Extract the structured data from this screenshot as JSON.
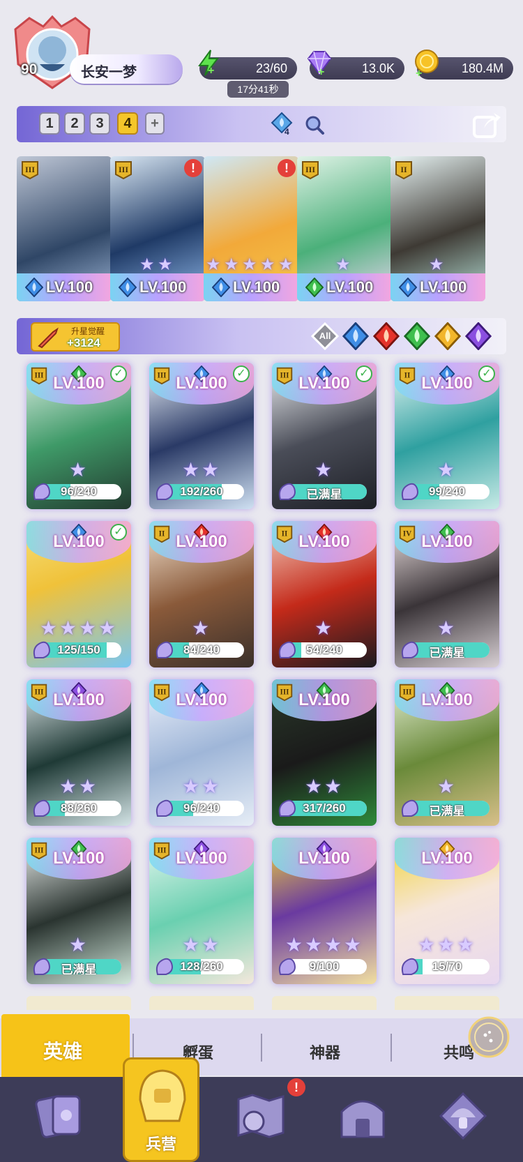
{
  "player": {
    "level": "90",
    "name": "长安一梦"
  },
  "resources": {
    "energy": "23/60",
    "energy_timer": "17分41秒",
    "gems": "13.0K",
    "gold": "180.4M"
  },
  "teams": {
    "tabs": [
      "1",
      "2",
      "3",
      "4",
      "+"
    ],
    "active": "4",
    "power_count": "4"
  },
  "team_cards": [
    {
      "level": "LV.100",
      "element": "water",
      "rank": "III",
      "alert": false,
      "stars": 0
    },
    {
      "level": "LV.100",
      "element": "water",
      "rank": "III",
      "alert": true,
      "stars": 2
    },
    {
      "level": "LV.100",
      "element": "water",
      "rank": "",
      "alert": true,
      "stars": 5
    },
    {
      "level": "LV.100",
      "element": "nature",
      "rank": "III",
      "alert": false,
      "stars": 1
    },
    {
      "level": "LV.100",
      "element": "water",
      "rank": "II",
      "alert": false,
      "stars": 1
    }
  ],
  "awaken": {
    "label": "升星觉醒",
    "value": "+3124"
  },
  "filters": [
    "All",
    "water",
    "fire",
    "nature",
    "light",
    "dark"
  ],
  "heroes": [
    {
      "level": "LV.100",
      "element": "nature",
      "rank": "III",
      "check": true,
      "count": "96/240",
      "progress": 0.4,
      "stars": 1
    },
    {
      "level": "LV.100",
      "element": "water",
      "rank": "III",
      "check": true,
      "count": "192/260",
      "progress": 0.74,
      "stars": 2
    },
    {
      "level": "LV.100",
      "element": "water",
      "rank": "III",
      "check": true,
      "count": "已满星",
      "progress": 1.0,
      "stars": 1
    },
    {
      "level": "LV.100",
      "element": "water",
      "rank": "II",
      "check": true,
      "count": "99/240",
      "progress": 0.41,
      "stars": 1
    },
    {
      "level": "LV.100",
      "element": "water",
      "rank": "",
      "check": true,
      "count": "125/150",
      "progress": 0.83,
      "stars": 4
    },
    {
      "level": "LV.100",
      "element": "fire",
      "rank": "II",
      "check": false,
      "count": "84/240",
      "progress": 0.35,
      "stars": 1
    },
    {
      "level": "LV.100",
      "element": "fire",
      "rank": "II",
      "check": false,
      "count": "54/240",
      "progress": 0.23,
      "stars": 1
    },
    {
      "level": "LV.100",
      "element": "nature",
      "rank": "IV",
      "check": false,
      "count": "已满星",
      "progress": 1.0,
      "stars": 1
    },
    {
      "level": "LV.100",
      "element": "dark",
      "rank": "III",
      "check": false,
      "count": "88/260",
      "progress": 0.34,
      "stars": 2
    },
    {
      "level": "LV.100",
      "element": "water",
      "rank": "III",
      "check": false,
      "count": "96/240",
      "progress": 0.4,
      "stars": 2
    },
    {
      "level": "LV.100",
      "element": "nature",
      "rank": "III",
      "check": false,
      "count": "317/260",
      "progress": 1.0,
      "stars": 2
    },
    {
      "level": "LV.100",
      "element": "nature",
      "rank": "III",
      "check": false,
      "count": "已满星",
      "progress": 1.0,
      "stars": 1
    },
    {
      "level": "LV.100",
      "element": "nature",
      "rank": "III",
      "check": false,
      "count": "已满星",
      "progress": 1.0,
      "stars": 1
    },
    {
      "level": "LV.100",
      "element": "dark",
      "rank": "III",
      "check": false,
      "count": "128/260",
      "progress": 0.49,
      "stars": 2
    },
    {
      "level": "LV.100",
      "element": "dark",
      "rank": "",
      "check": false,
      "count": "9/100",
      "progress": 0.09,
      "stars": 4
    },
    {
      "level": "LV.100",
      "element": "light",
      "rank": "",
      "check": false,
      "count": "15/70",
      "progress": 0.21,
      "stars": 3
    }
  ],
  "sub_tabs": [
    "英雄",
    "孵蛋",
    "神器",
    "共鸣"
  ],
  "nav": {
    "active_label": "兵营"
  }
}
